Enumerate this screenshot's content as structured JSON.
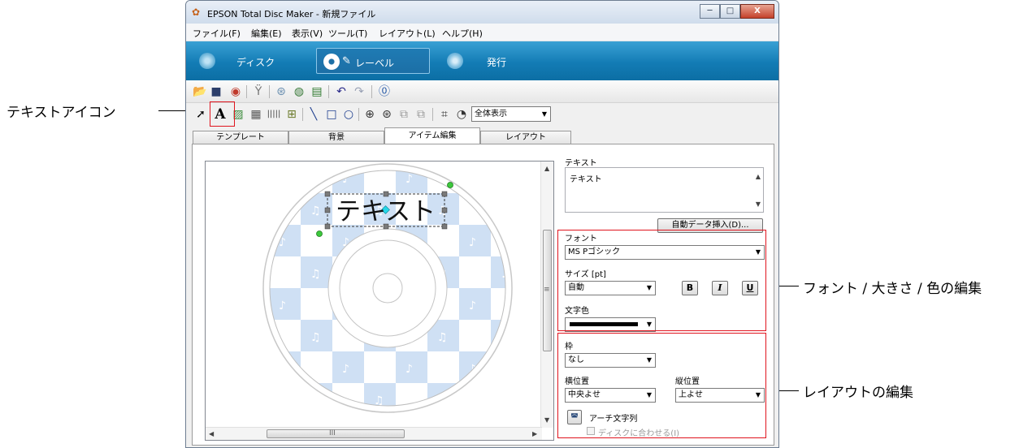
{
  "callouts": {
    "text_icon": "テキストアイコン",
    "font_edit": "フォント / 大きさ / 色の編集",
    "layout_edit": "レイアウトの編集"
  },
  "window": {
    "title": "EPSON Total Disc Maker - 新規ファイル",
    "controls": {
      "minimize": "─",
      "maximize": "□",
      "close": "X"
    }
  },
  "menu": [
    "ファイル(F)",
    "編集(E)",
    "表示(V)",
    "ツール(T)",
    "レイアウト(L)",
    "ヘルプ(H)"
  ],
  "modes": [
    {
      "label": "ディスク",
      "active": false
    },
    {
      "label": "レーベル",
      "active": true
    },
    {
      "label": "発行",
      "active": false
    }
  ],
  "toolbar": {
    "text_tool": "A",
    "zoom_value": "全体表示"
  },
  "tabs": [
    "テンプレート",
    "背景",
    "アイテム編集",
    "レイアウト"
  ],
  "active_tab": "アイテム編集",
  "canvas": {
    "label_text": "テキスト",
    "scroll_grip": "≡",
    "scroll_grip_h": "III"
  },
  "props": {
    "text_label": "テキスト",
    "text_value": "テキスト",
    "auto_insert_button": "自動データ挿入(D)...",
    "font_label": "フォント",
    "font_value": "MS Pゴシック",
    "size_label": "サイズ [pt]",
    "size_value": "自動",
    "bold": "B",
    "italic": "I",
    "underline": "U",
    "color_label": "文字色",
    "color_value": "#000000",
    "frame_label": "枠",
    "frame_value": "なし",
    "h_pos_label": "横位置",
    "h_pos_value": "中央よせ",
    "v_pos_label": "縦位置",
    "v_pos_value": "上よせ",
    "arch_label": "アーチ文字列",
    "fit_disc_label": "ディスクに合わせる(I)"
  },
  "colors": {
    "callout_red": "#e0141e",
    "mode_bar": "#137cb5",
    "checker": "#cfe0f4"
  }
}
